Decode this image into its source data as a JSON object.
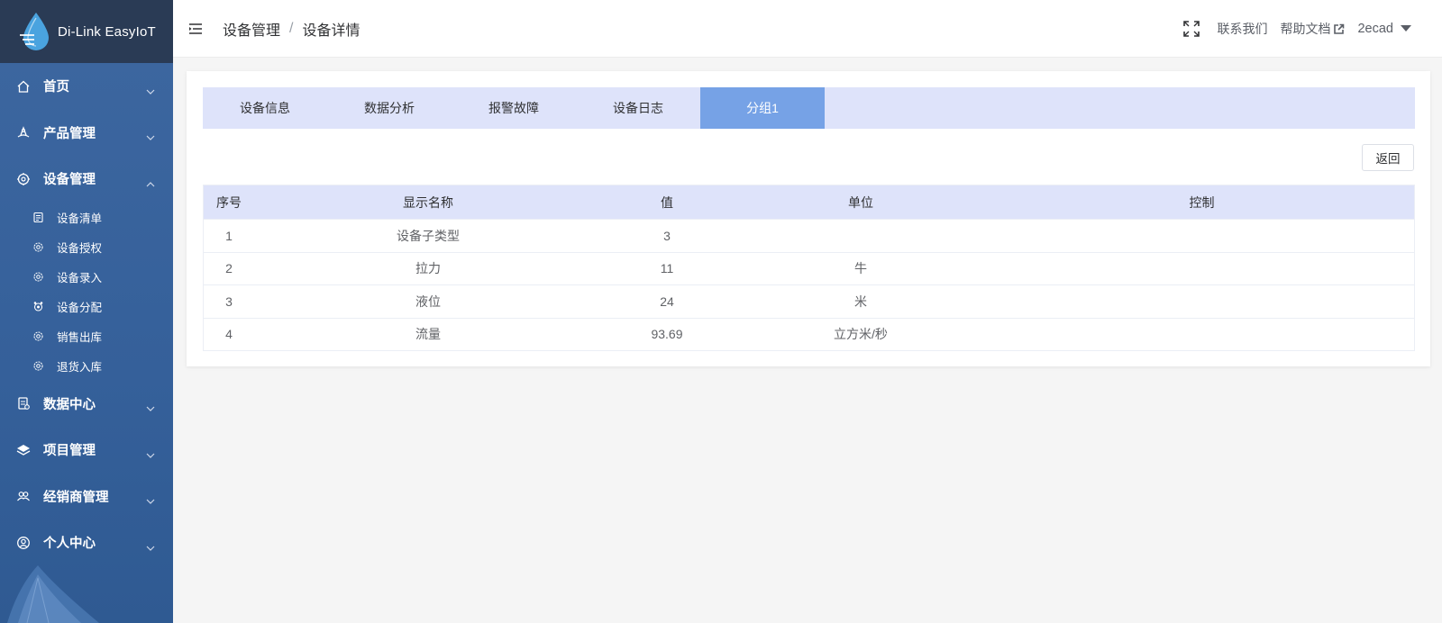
{
  "app": {
    "logo_text": "Di-Link EasyIoT"
  },
  "sidebar": {
    "items": [
      {
        "label": "首页",
        "icon": "home-icon"
      },
      {
        "label": "产品管理",
        "icon": "product-icon"
      },
      {
        "label": "设备管理",
        "icon": "device-icon",
        "expanded": true,
        "children": [
          {
            "label": "设备清单",
            "icon": "list-icon"
          },
          {
            "label": "设备授权",
            "icon": "gear-icon"
          },
          {
            "label": "设备录入",
            "icon": "gear-icon"
          },
          {
            "label": "设备分配",
            "icon": "assign-icon"
          },
          {
            "label": "销售出库",
            "icon": "gear-icon"
          },
          {
            "label": "退货入库",
            "icon": "gear-icon"
          }
        ]
      },
      {
        "label": "数据中心",
        "icon": "data-icon"
      },
      {
        "label": "项目管理",
        "icon": "layers-icon"
      },
      {
        "label": "经销商管理",
        "icon": "dealer-icon"
      },
      {
        "label": "个人中心",
        "icon": "user-circle-icon"
      }
    ]
  },
  "header": {
    "breadcrumb": [
      "设备管理",
      "设备详情"
    ],
    "separator": "/",
    "contact": "联系我们",
    "help": "帮助文档",
    "user": "2ecad"
  },
  "tabs": [
    {
      "label": "设备信息",
      "active": false
    },
    {
      "label": "数据分析",
      "active": false
    },
    {
      "label": "报警故障",
      "active": false
    },
    {
      "label": "设备日志",
      "active": false
    },
    {
      "label": "分组1",
      "active": true
    }
  ],
  "back_button": "返回",
  "table": {
    "columns": [
      "序号",
      "显示名称",
      "值",
      "单位",
      "控制"
    ],
    "rows": [
      {
        "index": "1",
        "name": "设备子类型",
        "value": "3",
        "unit": "",
        "control": ""
      },
      {
        "index": "2",
        "name": "拉力",
        "value": "11",
        "unit": "牛",
        "control": ""
      },
      {
        "index": "3",
        "name": "液位",
        "value": "24",
        "unit": "米",
        "control": ""
      },
      {
        "index": "4",
        "name": "流量",
        "value": "93.69",
        "unit": "立方米/秒",
        "control": ""
      }
    ]
  },
  "colors": {
    "sidebar_bg": "#3d67a0",
    "logo_bar_bg": "#2a3b55",
    "tab_bar_bg": "#dee3fa",
    "tab_active_bg": "#76a2e6",
    "page_bg": "#f5f5f5"
  }
}
